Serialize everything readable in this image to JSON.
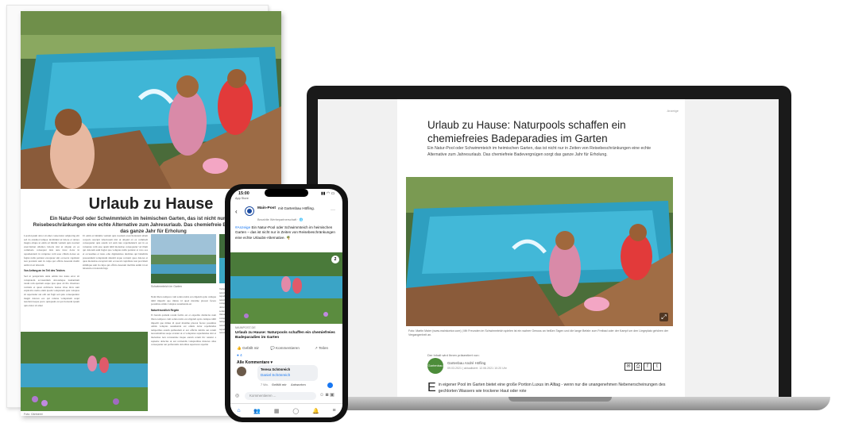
{
  "newspaper": {
    "headline": "Urlaub zu Hause",
    "lede": "Ein Natur-Pool oder Schwimmteich im heimischen Garten, das ist nicht nur in Zeiten von Reisebeschränkungen eine echte Alternative zum Jahresurlaub. Das chemiefreie Badevergnügen sorgt das ganze Jahr für Erholung",
    "subheads": [
      "Von Anfang an im Teil des Teiches",
      "Naturfreundlich Regeln"
    ],
    "captions": [
      "Schwimmteich im Garten",
      "Foto: Gärtnerei"
    ]
  },
  "laptop": {
    "ad_label": "Anzeige",
    "title": "Urlaub zu Hause: Naturpools schaffen ein chemiefreies Badeparadies im Garten",
    "intro": "Ein Natur-Pool oder Schwimmteich im heimischen Garten, das ist nicht nur in Zeiten von Reisebeschränkungen eine echte Alternative zum Jahresurlaub. Das chemiefreie Badevergnügen sorgt das ganze Jahr für Erholung.",
    "image_caption": "Foto: Martin Maier (www.mainkontor.com) | Mit Freunden im Schwimmteich spielen ist ein wahrer Genuss an heißen Tagen und die lange Befahr zum Freibad oder der Kampf um den Liegeplatz gehören der Vergangenheit an.",
    "promo_label": "Der Inhalt wird Ihnen präsentiert von:",
    "sponsor_logo": "Gartenbau",
    "sponsor_name": "Gartenbau André Höfling",
    "sponsor_date": "09.03.2021 | aktualisiert: 12.06.2021 10:20 Uhr",
    "body_dropcap": "E",
    "body": "in eigener Pool im Garten bietet eine große Portion Luxus im Alltag - wenn nur die unangenehmen Nebenerscheinungen des gechlorten Wassers wie trockene Haut oder rote",
    "share_icons": [
      "mail-icon",
      "print-icon",
      "facebook-icon",
      "twitter-icon"
    ]
  },
  "phone": {
    "time": "15:00",
    "back_label": "App Store",
    "page_name": "Main-Post",
    "with_text": "mit Gartenbau Höfling.",
    "partnership": "Bezahlte Werbepartnerschaft · 🌐",
    "post_link": "#Anzeige",
    "post_text": "Ein Natur-Pool oder Schwimmteich im heimischen Garten – das ist nicht nur in Zeiten von Reisebeschränkungen eine echte Urlaubs-Alternative.",
    "domain": "MAINPOST.DE",
    "link_title": "Urlaub zu Hause: Naturpools schaffen ein chemiefreies Badeparadies im Garten",
    "like_label": "Gefällt mir",
    "comment_label": "Kommentieren",
    "share_label": "Teilen",
    "reactions_count": "4",
    "comments_header": "Alle Kommentare",
    "commenter": "Teresa Schönreich",
    "mention": "Daniel Schönreich",
    "comment_time": "7 Wo.",
    "comment_like": "Gefällt mir",
    "comment_reply": "Antworten",
    "comment_placeholder": "Kommentieren ...",
    "photo_counter": "2"
  }
}
